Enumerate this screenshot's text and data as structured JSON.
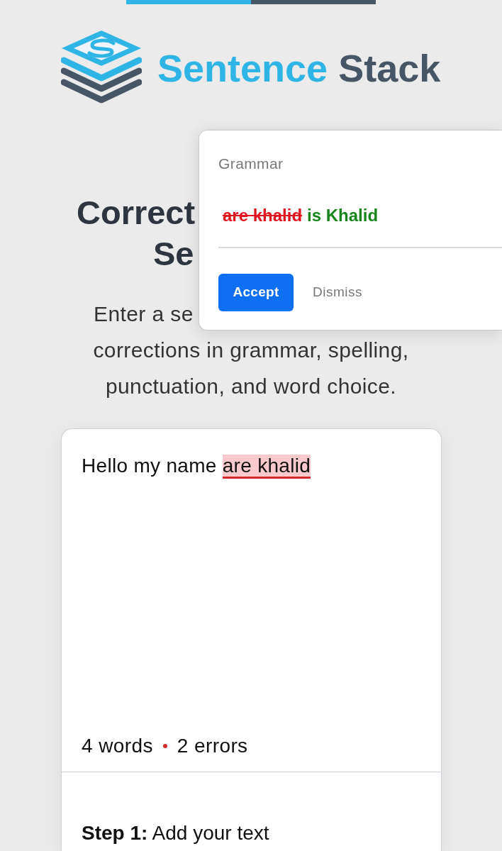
{
  "header": {
    "words": [
      {
        "text": "Sentence",
        "color": "#2eb5e5"
      },
      {
        "text": "Stack",
        "color": "#475666"
      }
    ]
  },
  "title_lines": [
    "Correct",
    "Se"
  ],
  "suggestion_popup": {
    "category": "Grammar",
    "removed": "are khalid",
    "replacement": "is Khalid",
    "buttons": [
      {
        "label": "Accept",
        "kind": "primary"
      },
      {
        "label": "Dismiss",
        "kind": "link"
      }
    ]
  },
  "subtitle_lines": [
    "Enter a se",
    "corrections in grammar, spelling,",
    "punctuation, and word choice."
  ],
  "editor": {
    "segments": [
      {
        "text": "Hello my name",
        "kind": "plain"
      },
      {
        "text": "are khalid",
        "kind": "error"
      }
    ],
    "word_count": "4 words",
    "error_count": "2 errors"
  },
  "steps": [
    "**Step 1:** Add your text"
  ]
}
